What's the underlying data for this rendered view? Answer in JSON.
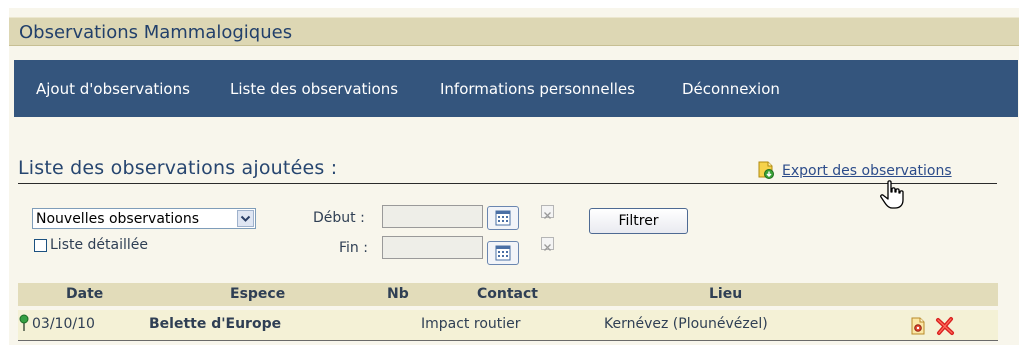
{
  "app": {
    "title": "Observations Mammalogiques"
  },
  "nav": {
    "items": [
      {
        "label": "Ajout d'observations"
      },
      {
        "label": "Liste des observations"
      },
      {
        "label": "Informations personnelles"
      },
      {
        "label": "Déconnexion"
      }
    ]
  },
  "section": {
    "title": "Liste des observations ajoutées :",
    "export_label": "Export des observations"
  },
  "filters": {
    "select_value": "Nouvelles observations",
    "detailed_label": "Liste détaillée",
    "detailed_checked": false,
    "start_label": "Début :",
    "end_label": "Fin :",
    "start_value": "",
    "end_value": "",
    "filter_button": "Filtrer"
  },
  "table": {
    "columns": [
      "Date",
      "Espece",
      "Nb",
      "Contact",
      "Lieu"
    ],
    "rows": [
      {
        "date": "03/10/10",
        "espece": "Belette d'Europe",
        "nb": "",
        "contact": "Impact routier",
        "lieu": "Kernévez (Plounévézel)"
      }
    ]
  },
  "icons": {
    "export": "export-spreadsheet-icon",
    "calendar": "calendar-icon",
    "clear": "clear-x-icon",
    "pin": "green-pin-icon",
    "view": "view-details-icon",
    "delete": "delete-icon",
    "cursor": "hand-cursor-icon"
  },
  "colors": {
    "nav_bg": "#34557d",
    "header_bg": "#ddd7b4",
    "table_header_bg": "#e2dcba",
    "row_bg": "#f4f1d6",
    "title_color": "#274670"
  }
}
